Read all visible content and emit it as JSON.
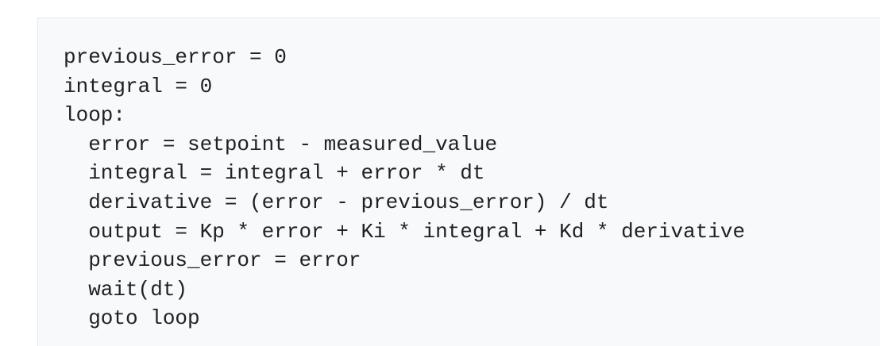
{
  "code_block": {
    "lines": [
      "previous_error = 0",
      "integral = 0",
      "loop:",
      "  error = setpoint - measured_value",
      "  integral = integral + error * dt",
      "  derivative = (error - previous_error) / dt",
      "  output = Kp * error + Ki * integral + Kd * derivative",
      "  previous_error = error",
      "  wait(dt)",
      "  goto loop"
    ],
    "colors": {
      "background": "#f8f9fa",
      "border": "#e6e8eb",
      "text": "#202122"
    }
  }
}
